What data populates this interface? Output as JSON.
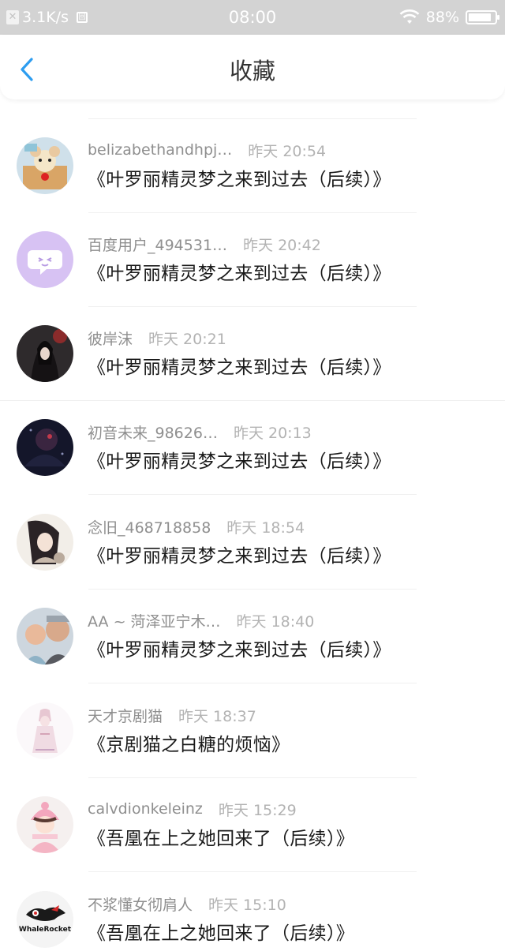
{
  "status_bar": {
    "speed": "3.1K/s",
    "time": "08:00",
    "battery": "88%",
    "battery_level": 0.88
  },
  "header": {
    "title": "收藏",
    "back_icon": "chevron-left-icon",
    "accent_color": "#2d9df0"
  },
  "items": [
    {
      "user": "belizabethandhpj…",
      "time": "昨天 20:54",
      "title": "《叶罗丽精灵梦之来到过去（后续）》"
    },
    {
      "user": "百度用户_494531…",
      "time": "昨天 20:42",
      "title": "《叶罗丽精灵梦之来到过去（后续）》"
    },
    {
      "user": "彼岸沫",
      "time": "昨天 20:21",
      "title": "《叶罗丽精灵梦之来到过去（后续）》"
    },
    {
      "user": "初音未来_98626…",
      "time": "昨天 20:13",
      "title": "《叶罗丽精灵梦之来到过去（后续）》"
    },
    {
      "user": "念旧_468718858",
      "time": "昨天 18:54",
      "title": "《叶罗丽精灵梦之来到过去（后续）》"
    },
    {
      "user": "AA ~ 菏泽亚宁木…",
      "time": "昨天 18:40",
      "title": "《叶罗丽精灵梦之来到过去（后续）》"
    },
    {
      "user": "天才京剧猫",
      "time": "昨天 18:37",
      "title": "《京剧猫之白糖的烦恼》"
    },
    {
      "user": "calvdionkeleinz",
      "time": "昨天 15:29",
      "title": "《吾凰在上之她回来了（后续）》"
    },
    {
      "user": "不浆懂女彻肩人",
      "time": "昨天 15:10",
      "title": "《吾凰在上之她回来了（后续）》"
    }
  ],
  "avatar_logo_text": "WhaleRocket"
}
